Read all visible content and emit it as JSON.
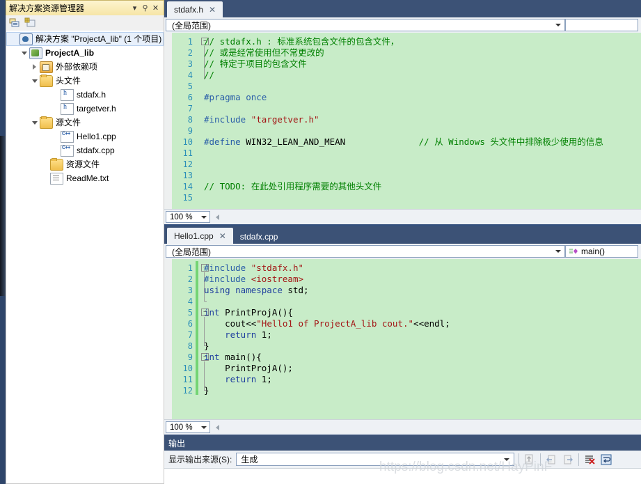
{
  "solution_explorer": {
    "title": "解决方案资源管理器",
    "header_buttons": [
      {
        "name": "dropdown",
        "glyph": "▾"
      },
      {
        "name": "pin",
        "glyph": "⚲"
      },
      {
        "name": "close",
        "glyph": "✕"
      }
    ],
    "toolbar_icons": [
      "properties-icon",
      "show-all-files-icon"
    ],
    "tree": [
      {
        "label": "解决方案 \"ProjectA_lib\" (1 个项目)",
        "icon": "solution-icon",
        "indent": 0,
        "expander": "none",
        "selected": true,
        "bold": false
      },
      {
        "label": "ProjectA_lib",
        "icon": "project-icon",
        "indent": 1,
        "expander": "open",
        "selected": false,
        "bold": true
      },
      {
        "label": "外部依赖项",
        "icon": "folder-dep-icon",
        "indent": 2,
        "expander": "closed",
        "selected": false,
        "bold": false
      },
      {
        "label": "头文件",
        "icon": "folder-icon",
        "indent": 2,
        "expander": "open",
        "selected": false,
        "bold": false
      },
      {
        "label": "stdafx.h",
        "icon": "header-file-icon",
        "indent": 4,
        "expander": "none",
        "selected": false,
        "bold": false
      },
      {
        "label": "targetver.h",
        "icon": "header-file-icon",
        "indent": 4,
        "expander": "none",
        "selected": false,
        "bold": false
      },
      {
        "label": "源文件",
        "icon": "folder-icon",
        "indent": 2,
        "expander": "open",
        "selected": false,
        "bold": false
      },
      {
        "label": "Hello1.cpp",
        "icon": "cpp-file-icon",
        "indent": 4,
        "expander": "none",
        "selected": false,
        "bold": false
      },
      {
        "label": "stdafx.cpp",
        "icon": "cpp-file-icon",
        "indent": 4,
        "expander": "none",
        "selected": false,
        "bold": false
      },
      {
        "label": "资源文件",
        "icon": "folder-icon",
        "indent": 3,
        "expander": "none",
        "selected": false,
        "bold": false
      },
      {
        "label": "ReadMe.txt",
        "icon": "text-file-icon",
        "indent": 3,
        "expander": "none",
        "selected": false,
        "bold": false
      }
    ]
  },
  "editor_top": {
    "tabs": [
      {
        "label": "stdafx.h",
        "active": true,
        "closable": true
      }
    ],
    "scope_left": "(全局范围)",
    "scope_right": "",
    "zoom": "100 %",
    "lines": [
      {
        "n": 1,
        "fold": "open",
        "segs": [
          {
            "t": "// stdafx.h : 标准系统包含文件的包含文件，",
            "c": "cmt"
          }
        ]
      },
      {
        "n": 2,
        "fold": "bar",
        "segs": [
          {
            "t": "// 或是经常使用但不常更改的",
            "c": "cmt"
          }
        ]
      },
      {
        "n": 3,
        "fold": "bar",
        "segs": [
          {
            "t": "// 特定于项目的包含文件",
            "c": "cmt"
          }
        ]
      },
      {
        "n": 4,
        "fold": "bar",
        "segs": [
          {
            "t": "//",
            "c": "cmt"
          }
        ]
      },
      {
        "n": 5,
        "fold": "none",
        "segs": []
      },
      {
        "n": 6,
        "fold": "none",
        "segs": [
          {
            "t": "#pragma once",
            "c": "pp"
          }
        ]
      },
      {
        "n": 7,
        "fold": "none",
        "segs": []
      },
      {
        "n": 8,
        "fold": "none",
        "segs": [
          {
            "t": "#include ",
            "c": "pp"
          },
          {
            "t": "\"targetver.h\"",
            "c": "str"
          }
        ]
      },
      {
        "n": 9,
        "fold": "none",
        "segs": []
      },
      {
        "n": 10,
        "fold": "none",
        "segs": [
          {
            "t": "#define ",
            "c": "pp"
          },
          {
            "t": "WIN32_LEAN_AND_MEAN",
            "c": "pl"
          },
          {
            "t": "              // 从 Windows 头文件中排除极少使用的信息",
            "c": "cmt"
          }
        ]
      },
      {
        "n": 11,
        "fold": "none",
        "segs": []
      },
      {
        "n": 12,
        "fold": "none",
        "segs": []
      },
      {
        "n": 13,
        "fold": "none",
        "segs": []
      },
      {
        "n": 14,
        "fold": "none",
        "segs": [
          {
            "t": "// TODO: 在此处引用程序需要的其他头文件",
            "c": "cmt"
          }
        ]
      },
      {
        "n": 15,
        "fold": "none",
        "segs": []
      }
    ]
  },
  "editor_bottom": {
    "tabs": [
      {
        "label": "Hello1.cpp",
        "active": true,
        "closable": true
      },
      {
        "label": "stdafx.cpp",
        "active": false,
        "closable": false
      }
    ],
    "scope_left": "(全局范围)",
    "scope_right": "main()",
    "scope_right_icon": "method-icon",
    "zoom": "100 %",
    "lines": [
      {
        "n": 1,
        "fold": "open",
        "change": true,
        "segs": [
          {
            "t": "#include ",
            "c": "pp"
          },
          {
            "t": "\"stdafx.h\"",
            "c": "str"
          }
        ]
      },
      {
        "n": 2,
        "fold": "bar",
        "change": true,
        "segs": [
          {
            "t": "#include ",
            "c": "pp"
          },
          {
            "t": "<iostream>",
            "c": "str"
          }
        ]
      },
      {
        "n": 3,
        "fold": "bar",
        "change": true,
        "segs": [
          {
            "t": "using namespace ",
            "c": "kw"
          },
          {
            "t": "std;",
            "c": "pl"
          }
        ]
      },
      {
        "n": 4,
        "fold": "end",
        "change": true,
        "segs": []
      },
      {
        "n": 5,
        "fold": "open",
        "change": true,
        "segs": [
          {
            "t": "int ",
            "c": "kw"
          },
          {
            "t": "PrintProjA(){",
            "c": "pl"
          }
        ]
      },
      {
        "n": 6,
        "fold": "bar",
        "change": true,
        "segs": [
          {
            "t": "    cout<<",
            "c": "pl"
          },
          {
            "t": "\"Hello1 of ProjectA_lib cout.\"",
            "c": "str"
          },
          {
            "t": "<<endl;",
            "c": "pl"
          }
        ]
      },
      {
        "n": 7,
        "fold": "bar",
        "change": true,
        "segs": [
          {
            "t": "    ",
            "c": "pl"
          },
          {
            "t": "return ",
            "c": "kw"
          },
          {
            "t": "1;",
            "c": "pl"
          }
        ]
      },
      {
        "n": 8,
        "fold": "end",
        "change": true,
        "segs": [
          {
            "t": "}",
            "c": "pl"
          }
        ]
      },
      {
        "n": 9,
        "fold": "open",
        "change": true,
        "segs": [
          {
            "t": "int ",
            "c": "kw"
          },
          {
            "t": "main(){",
            "c": "pl"
          }
        ]
      },
      {
        "n": 10,
        "fold": "bar",
        "change": true,
        "segs": [
          {
            "t": "    PrintProjA();",
            "c": "pl"
          }
        ]
      },
      {
        "n": 11,
        "fold": "bar",
        "change": true,
        "segs": [
          {
            "t": "    ",
            "c": "pl"
          },
          {
            "t": "return ",
            "c": "kw"
          },
          {
            "t": "1;",
            "c": "pl"
          }
        ]
      },
      {
        "n": 12,
        "fold": "end",
        "change": true,
        "segs": [
          {
            "t": "}",
            "c": "pl"
          }
        ]
      }
    ]
  },
  "output_pane": {
    "title": "输出",
    "source_label": "显示输出来源(S):",
    "source_value": "生成",
    "toolbar_icons": [
      "find-message-icon",
      "go-to-previous-icon",
      "go-to-next-icon",
      "clear-all-icon",
      "toggle-word-wrap-icon"
    ]
  },
  "watermark": "https://blog.csdn.net/HayPinF",
  "colors": {
    "chrome": "#34507c",
    "tabstrip": "#3c5276",
    "code_bg": "#c8ecc8",
    "comment": "#008000",
    "preprocessor": "#2b5fa8",
    "string": "#a31515",
    "keyword": "#1f3f9e",
    "line_number": "#2b8fb8",
    "change_bar": "#74d474",
    "se_header_start": "#fdf4cf",
    "se_header_end": "#f6e5a6"
  }
}
